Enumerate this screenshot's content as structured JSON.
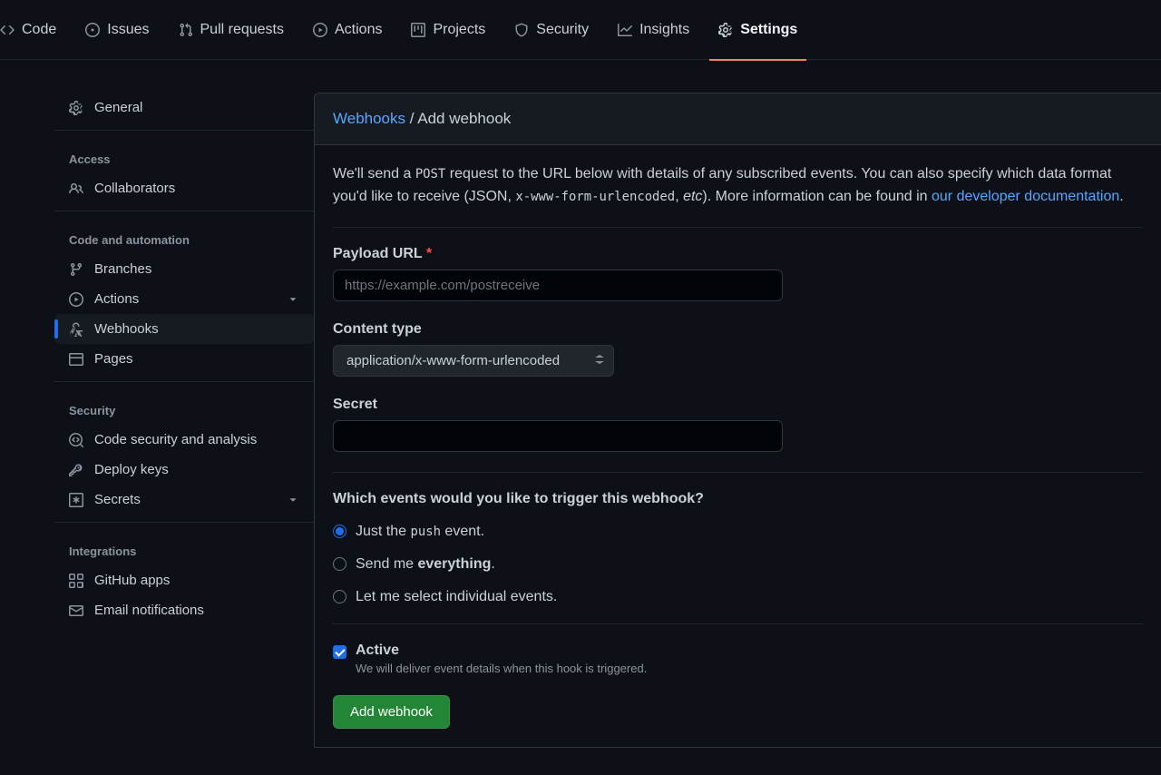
{
  "topnav": {
    "items": [
      {
        "label": "Code"
      },
      {
        "label": "Issues"
      },
      {
        "label": "Pull requests"
      },
      {
        "label": "Actions"
      },
      {
        "label": "Projects"
      },
      {
        "label": "Security"
      },
      {
        "label": "Insights"
      },
      {
        "label": "Settings"
      }
    ]
  },
  "sidebar": {
    "general": "General",
    "groups": {
      "access": {
        "heading": "Access",
        "items": [
          {
            "label": "Collaborators"
          }
        ]
      },
      "code_auto": {
        "heading": "Code and automation",
        "items": [
          {
            "label": "Branches"
          },
          {
            "label": "Actions"
          },
          {
            "label": "Webhooks"
          },
          {
            "label": "Pages"
          }
        ]
      },
      "security": {
        "heading": "Security",
        "items": [
          {
            "label": "Code security and analysis"
          },
          {
            "label": "Deploy keys"
          },
          {
            "label": "Secrets"
          }
        ]
      },
      "integrations": {
        "heading": "Integrations",
        "items": [
          {
            "label": "GitHub apps"
          },
          {
            "label": "Email notifications"
          }
        ]
      }
    }
  },
  "breadcrumb": {
    "root": "Webhooks",
    "sep": " / ",
    "current": "Add webhook"
  },
  "desc": {
    "pre": "We'll send a ",
    "post_code": "POST",
    "mid1": " request to the URL below with details of any subscribed events. You can also specify which data format you'd like to receive (JSON, ",
    "enc_code": "x-www-form-urlencoded",
    "mid2": ", ",
    "etc": "etc",
    "mid3": "). More information can be found in ",
    "link": "our developer documentation",
    "end": "."
  },
  "form": {
    "payload_label": "Payload URL",
    "payload_placeholder": "https://example.com/postreceive",
    "content_type_label": "Content type",
    "content_type_value": "application/x-www-form-urlencoded",
    "secret_label": "Secret",
    "trigger_heading": "Which events would you like to trigger this webhook?",
    "r1_pre": "Just the ",
    "r1_code": "push",
    "r1_post": " event.",
    "r2_pre": "Send me ",
    "r2_strong": "everything",
    "r2_post": ".",
    "r3": "Let me select individual events.",
    "active_label": "Active",
    "active_sub": "We will deliver event details when this hook is triggered.",
    "submit": "Add webhook"
  }
}
